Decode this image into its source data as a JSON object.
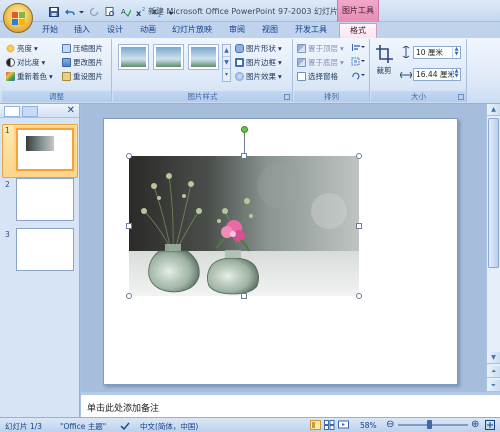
{
  "title_bar": {
    "text": "新建 Microsoft Office PowerPoint 97-2003 幻灯片...",
    "context_group": "图片工具"
  },
  "tabs": [
    {
      "label": "开始"
    },
    {
      "label": "插入"
    },
    {
      "label": "设计"
    },
    {
      "label": "动画"
    },
    {
      "label": "幻灯片放映"
    },
    {
      "label": "审阅"
    },
    {
      "label": "视图"
    },
    {
      "label": "开发工具"
    },
    {
      "label": "格式"
    }
  ],
  "ribbon": {
    "adjust": {
      "label": "调整",
      "brightness": "亮度",
      "contrast": "对比度",
      "recolor": "重新着色",
      "compress": "压缩图片",
      "change": "更改图片",
      "reset": "重设图片"
    },
    "styles": {
      "label": "图片样式",
      "shape": "图片形状",
      "border": "图片边框",
      "effects": "图片效果"
    },
    "arrange": {
      "label": "排列",
      "bring_front": "置于顶层",
      "send_back": "置于底层",
      "selection_pane": "选择窗格"
    },
    "size": {
      "label": "大小",
      "crop": "裁剪",
      "height": "10 厘米",
      "width": "16.44 厘米"
    }
  },
  "slides_panel": {
    "slide_numbers": [
      "1",
      "2",
      "3"
    ]
  },
  "notes": {
    "placeholder": "单击此处添加备注"
  },
  "status": {
    "slide": "幻灯片 1/3",
    "theme": "\"Office 主题\"",
    "language": "中文(简体，中国)",
    "zoom": "58%"
  }
}
